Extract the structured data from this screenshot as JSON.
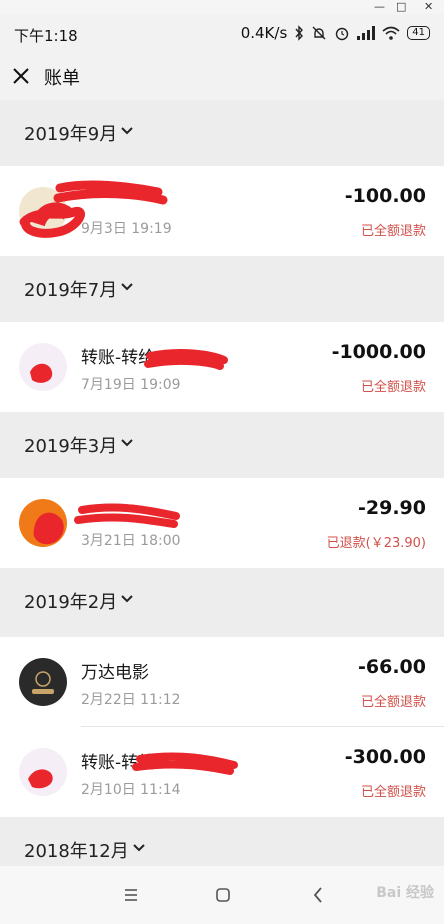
{
  "status_bar": {
    "time": "下午1:18",
    "net_speed": "0.4K/s",
    "battery": "41"
  },
  "header": {
    "title": "账单"
  },
  "months": [
    {
      "label": "2019年9月"
    },
    {
      "label": "2019年7月"
    },
    {
      "label": "2019年3月"
    },
    {
      "label": "2019年2月"
    },
    {
      "label": "2018年12月"
    }
  ],
  "transactions": [
    {
      "name": "",
      "date": "9月3日 19:19",
      "amount": "-100.00",
      "status": "已全额退款"
    },
    {
      "name": "转账-转给",
      "date": "7月19日 19:09",
      "amount": "-1000.00",
      "status": "已全额退款"
    },
    {
      "name": "",
      "date": "3月21日 18:00",
      "amount": "-29.90",
      "status": "已退款(￥23.90)"
    },
    {
      "name": "万达电影",
      "date": "2月22日 11:12",
      "amount": "-66.00",
      "status": "已全额退款"
    },
    {
      "name": "转账-转给",
      "date": "2月10日 11:14",
      "amount": "-300.00",
      "status": "已全额退款"
    }
  ],
  "watermark": "Bai 经验",
  "colors": {
    "refund_red": "#d2504a",
    "background": "#ededed",
    "redaction": "#e8262c"
  }
}
